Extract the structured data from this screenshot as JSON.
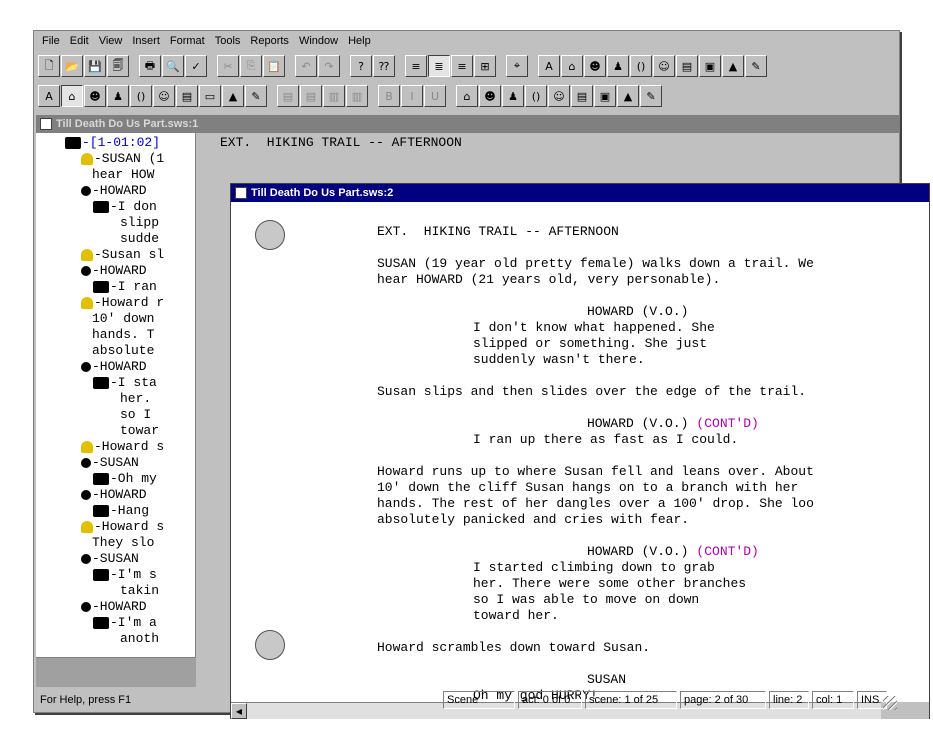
{
  "menu": [
    {
      "label": "File",
      "key": "F",
      "rest": "ile"
    },
    {
      "label": "Edit",
      "key": "E",
      "rest": "dit"
    },
    {
      "label": "View",
      "key": "V",
      "rest": "iew"
    },
    {
      "label": "Insert",
      "key": "I",
      "rest": "nsert"
    },
    {
      "label": "Format",
      "key": "",
      "rest": "Format"
    },
    {
      "label": "Tools",
      "key": "T",
      "rest": "ools"
    },
    {
      "label": "Reports",
      "key": "R",
      "rest": "eports"
    },
    {
      "label": "Window",
      "key": "W",
      "rest": "indow"
    },
    {
      "label": "Help",
      "key": "H",
      "rest": "elp"
    }
  ],
  "toolbar1": [
    {
      "name": "new-file-icon",
      "glyph": "🗋"
    },
    {
      "name": "open-folder-icon",
      "glyph": "📂"
    },
    {
      "name": "save-icon",
      "glyph": "💾"
    },
    {
      "name": "save-all-icon",
      "glyph": "🗐"
    },
    {
      "name": "print-icon",
      "glyph": "🖶"
    },
    {
      "name": "print-preview-icon",
      "glyph": "🔍"
    },
    {
      "name": "spell-check-icon",
      "glyph": "✓"
    },
    {
      "name": "cut-icon",
      "glyph": "✂",
      "disabled": true
    },
    {
      "name": "copy-icon",
      "glyph": "⎘",
      "disabled": true
    },
    {
      "name": "paste-icon",
      "glyph": "📋"
    },
    {
      "name": "undo-icon",
      "glyph": "↶",
      "disabled": true
    },
    {
      "name": "redo-icon",
      "glyph": "↷",
      "disabled": true
    },
    {
      "name": "help-icon",
      "glyph": "?"
    },
    {
      "name": "context-help-icon",
      "glyph": "⁇"
    },
    {
      "name": "align-left-icon",
      "glyph": "≡"
    },
    {
      "name": "align-center-icon",
      "glyph": "≣",
      "pressed": true
    },
    {
      "name": "align-right-icon",
      "glyph": "≡"
    },
    {
      "name": "table-icon",
      "glyph": "⊞"
    },
    {
      "name": "binoculars-icon",
      "glyph": "⌖"
    },
    {
      "name": "script-element-a-icon",
      "glyph": "A"
    },
    {
      "name": "scene-heading-icon",
      "glyph": "⌂"
    },
    {
      "name": "action-icon",
      "glyph": "☻"
    },
    {
      "name": "character-icon",
      "glyph": "♟"
    },
    {
      "name": "parenthetical-icon",
      "glyph": "()"
    },
    {
      "name": "dialogue-icon",
      "glyph": "☺"
    },
    {
      "name": "transition-icon",
      "glyph": "▤"
    },
    {
      "name": "shot-icon",
      "glyph": "▣"
    },
    {
      "name": "act-icon",
      "glyph": "▲"
    },
    {
      "name": "note-icon",
      "glyph": "✎"
    }
  ],
  "toolbar2": [
    {
      "name": "format-a-icon",
      "glyph": "A"
    },
    {
      "name": "scene-icon",
      "glyph": "⌂",
      "pressed": true
    },
    {
      "name": "action-figure-icon",
      "glyph": "☻"
    },
    {
      "name": "character-head-icon",
      "glyph": "♟"
    },
    {
      "name": "parentheses-icon",
      "glyph": "()"
    },
    {
      "name": "dialogue-faces-icon",
      "glyph": "☺"
    },
    {
      "name": "transition-bar-icon",
      "glyph": "▤"
    },
    {
      "name": "page-icon",
      "glyph": "▭"
    },
    {
      "name": "house-icon",
      "glyph": "▲"
    },
    {
      "name": "label-icon",
      "glyph": "✎"
    },
    {
      "name": "justify-1-icon",
      "glyph": "▤",
      "disabled": true
    },
    {
      "name": "justify-2-icon",
      "glyph": "▤",
      "disabled": true
    },
    {
      "name": "justify-3-icon",
      "glyph": "▥",
      "disabled": true
    },
    {
      "name": "justify-4-icon",
      "glyph": "▥",
      "disabled": true
    },
    {
      "name": "bold-icon",
      "glyph": "B",
      "disabled": true
    },
    {
      "name": "italic-icon",
      "glyph": "I",
      "disabled": true
    },
    {
      "name": "underline-icon",
      "glyph": "U",
      "disabled": true
    },
    {
      "name": "scene-set-icon",
      "glyph": "⌂"
    },
    {
      "name": "action-set-icon",
      "glyph": "☻"
    },
    {
      "name": "character-set-icon",
      "glyph": "♟"
    },
    {
      "name": "paren-set-icon",
      "glyph": "()"
    },
    {
      "name": "dialogue-set-icon",
      "glyph": "☺"
    },
    {
      "name": "transition-set-icon",
      "glyph": "▤"
    },
    {
      "name": "shot-set-icon",
      "glyph": "▣"
    },
    {
      "name": "act-set-icon",
      "glyph": "▲"
    },
    {
      "name": "note-set-icon",
      "glyph": "✎"
    }
  ],
  "window1": {
    "title": "Till Death Do Us Part.sws:1",
    "peek_text": "EXT.  HIKING TRAIL -- AFTERNOON",
    "tree": [
      {
        "prefix": "-⊟-",
        "icon": "scene",
        "text": "-[1-01:02]",
        "indent": 1,
        "blue": true
      },
      {
        "prefix": "-",
        "icon": "action",
        "text": "-SUSAN (1",
        "indent": 2
      },
      {
        "prefix": "",
        "icon": "",
        "text": "hear HOW",
        "indent": 3
      },
      {
        "prefix": "-⊟-",
        "icon": "character",
        "text": "-HOWARD",
        "indent": 2
      },
      {
        "prefix": "└",
        "icon": "dialogue",
        "text": "-I don",
        "indent": 3
      },
      {
        "prefix": "",
        "icon": "",
        "text": "slipp",
        "indent": 4
      },
      {
        "prefix": "",
        "icon": "",
        "text": "sudde",
        "indent": 4
      },
      {
        "prefix": "-",
        "icon": "action",
        "text": "-Susan sl",
        "indent": 2
      },
      {
        "prefix": "-⊟-",
        "icon": "character",
        "text": "-HOWARD",
        "indent": 2
      },
      {
        "prefix": "└",
        "icon": "dialogue",
        "text": "-I ran",
        "indent": 3
      },
      {
        "prefix": "-",
        "icon": "action",
        "text": "-Howard r",
        "indent": 2
      },
      {
        "prefix": "",
        "icon": "",
        "text": "10' down",
        "indent": 3
      },
      {
        "prefix": "",
        "icon": "",
        "text": "hands. T",
        "indent": 3
      },
      {
        "prefix": "",
        "icon": "",
        "text": "absolute",
        "indent": 3
      },
      {
        "prefix": "-⊟-",
        "icon": "character",
        "text": "-HOWARD",
        "indent": 2
      },
      {
        "prefix": "└",
        "icon": "dialogue",
        "text": "-I sta",
        "indent": 3
      },
      {
        "prefix": "",
        "icon": "",
        "text": "her.",
        "indent": 4
      },
      {
        "prefix": "",
        "icon": "",
        "text": "so I",
        "indent": 4
      },
      {
        "prefix": "",
        "icon": "",
        "text": "towar",
        "indent": 4
      },
      {
        "prefix": "-",
        "icon": "action",
        "text": "-Howard s",
        "indent": 2
      },
      {
        "prefix": "-⊟-",
        "icon": "character",
        "text": "-SUSAN",
        "indent": 2
      },
      {
        "prefix": "└",
        "icon": "dialogue",
        "text": "-Oh my",
        "indent": 3
      },
      {
        "prefix": "-⊟-",
        "icon": "character",
        "text": "-HOWARD",
        "indent": 2
      },
      {
        "prefix": "└",
        "icon": "dialogue",
        "text": "-Hang",
        "indent": 3
      },
      {
        "prefix": "-",
        "icon": "action",
        "text": "-Howard s",
        "indent": 2
      },
      {
        "prefix": "",
        "icon": "",
        "text": "They slo",
        "indent": 3
      },
      {
        "prefix": "-⊟-",
        "icon": "character",
        "text": "-SUSAN",
        "indent": 2
      },
      {
        "prefix": "└",
        "icon": "dialogue",
        "text": "-I'm s",
        "indent": 3
      },
      {
        "prefix": "",
        "icon": "",
        "text": "takin",
        "indent": 4
      },
      {
        "prefix": "-⊟-",
        "icon": "character",
        "text": "-HOWARD",
        "indent": 2
      },
      {
        "prefix": "└",
        "icon": "dialogue",
        "text": "-I'm a",
        "indent": 3
      },
      {
        "prefix": "",
        "icon": "",
        "text": "anoth",
        "indent": 4
      }
    ]
  },
  "window2": {
    "title": "Till Death Do Us Part.sws:2",
    "lines": [
      {
        "text": "EXT.  HIKING TRAIL -- AFTERNOON",
        "col": 0
      },
      {
        "text": "",
        "col": 0
      },
      {
        "text": "SUSAN (19 year old pretty female) walks down a trail. We",
        "col": 0
      },
      {
        "text": "hear HOWARD (21 years old, very personable).",
        "col": 0
      },
      {
        "text": "",
        "col": 0
      },
      {
        "text": "HOWARD (V.O.)",
        "col": 3
      },
      {
        "text": "I don't know what happened. She",
        "col": 1
      },
      {
        "text": "slipped or something. She just",
        "col": 1
      },
      {
        "text": "suddenly wasn't there.",
        "col": 1
      },
      {
        "text": "",
        "col": 0
      },
      {
        "text": "Susan slips and then slides over the edge of the trail.",
        "col": 0
      },
      {
        "text": "",
        "col": 0
      },
      {
        "text": "HOWARD (V.O.)",
        "col": 3,
        "contd": "(CONT'D)"
      },
      {
        "text": "I ran up there as fast as I could.",
        "col": 1
      },
      {
        "text": "",
        "col": 0
      },
      {
        "text": "Howard runs up to where Susan fell and leans over. About",
        "col": 0
      },
      {
        "text": "10' down the cliff Susan hangs on to a branch with her",
        "col": 0
      },
      {
        "text": "hands. The rest of her dangles over a 100' drop. She loo",
        "col": 0
      },
      {
        "text": "absolutely panicked and cries with fear.",
        "col": 0
      },
      {
        "text": "",
        "col": 0
      },
      {
        "text": "HOWARD (V.O.)",
        "col": 3,
        "contd": "(CONT'D)"
      },
      {
        "text": "I started climbing down to grab",
        "col": 1
      },
      {
        "text": "her. There were some other branches",
        "col": 1
      },
      {
        "text": "so I was able to move on down",
        "col": 1
      },
      {
        "text": "toward her.",
        "col": 1
      },
      {
        "text": "",
        "col": 0
      },
      {
        "text": "Howard scrambles down toward Susan.",
        "col": 0
      },
      {
        "text": "",
        "col": 0
      },
      {
        "text": "SUSAN",
        "col": 3
      },
      {
        "text": "Oh my god HURRY!",
        "col": 1
      }
    ]
  },
  "status": {
    "help": "For Help, press F1",
    "element": "Scene",
    "act": "act: 0 of 0",
    "scene": "scene: 1 of 25",
    "page": "page: 2 of 30",
    "line": "line: 2",
    "col": "col: 1",
    "mode": "INS"
  },
  "colors": {
    "active_title": "#000080",
    "inactive_title": "#808080",
    "contd": "#b000b0",
    "tree_blue": "#0000c0"
  }
}
